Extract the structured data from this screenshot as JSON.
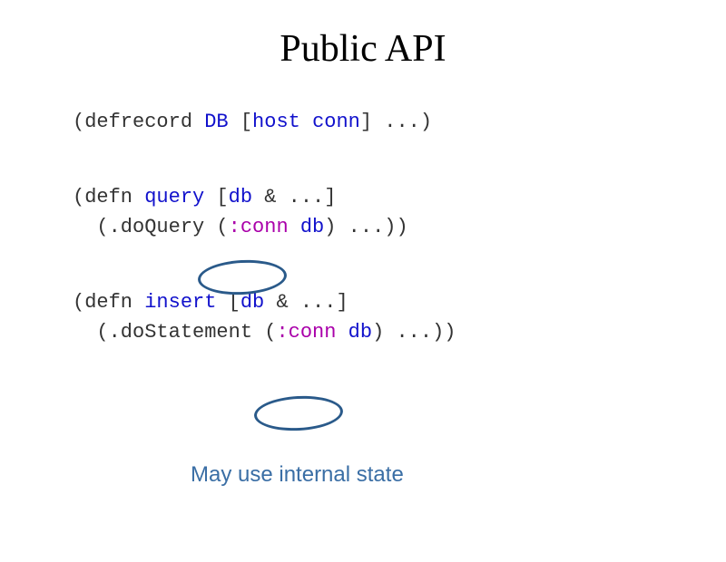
{
  "title": "Public API",
  "code": {
    "defrecord": {
      "open": "(",
      "keyword": "defrecord",
      "space1": " ",
      "name": "DB",
      "space2": " [",
      "param1": "host",
      "space3": " ",
      "param2": "conn",
      "close": "] ...)"
    },
    "query": {
      "line1": {
        "open": "(",
        "keyword": "defn",
        "space1": " ",
        "name": "query",
        "space2": " [",
        "param1": "db",
        "space3": " & ...]"
      },
      "line2": {
        "indent": "  (.doQuery (",
        "kw": ":conn",
        "space": " ",
        "param": "db",
        "close": ") ...))"
      }
    },
    "insert": {
      "line1": {
        "open": "(",
        "keyword": "defn",
        "space1": " ",
        "name": "insert",
        "space2": " [",
        "param1": "db",
        "space3": " & ...]"
      },
      "line2": {
        "indent": "  (.doStatement (",
        "kw": ":conn",
        "space": " ",
        "param": "db",
        "close": ") ...))"
      }
    }
  },
  "annotation": "May use internal state"
}
